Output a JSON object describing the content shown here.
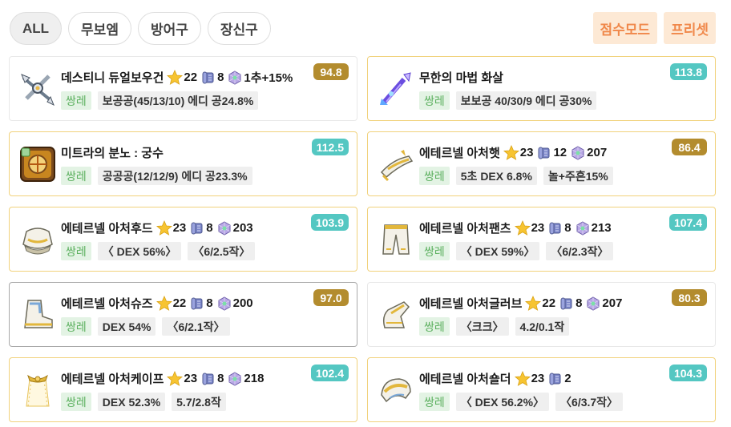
{
  "filters": {
    "tabs": [
      {
        "label": "ALL"
      },
      {
        "label": "무보엠"
      },
      {
        "label": "방어구"
      },
      {
        "label": "장신구"
      }
    ],
    "score_mode_label": "점수모드",
    "preset_label": "프리셋"
  },
  "colors": {
    "score_gold": "#b38c2e",
    "score_teal": "#54c7c2",
    "accent_orange": "#f0884a",
    "set_green": "#5cb05f"
  },
  "items": [
    {
      "name": "데스티니 듀얼보우건",
      "stars": "22",
      "scrolls": "8",
      "potential": "1추+15%",
      "set": "쌍레",
      "tags": [
        "보공공(45/13/10) 에디 공24.8%"
      ],
      "score": "94.8",
      "score_color": "gold",
      "icon": "crossbow-icon"
    },
    {
      "name": "무한의 마법 화살",
      "stars": "",
      "scrolls": "",
      "potential": "",
      "set": "쌍레",
      "tags": [
        "보보공 40/30/9 에디 공30%"
      ],
      "score": "113.8",
      "score_color": "teal",
      "icon": "magic-arrow-icon"
    },
    {
      "name": "미트라의 분노 : 궁수",
      "stars": "",
      "scrolls": "",
      "potential": "",
      "set": "쌍레",
      "tags": [
        "공공공(12/12/9) 에디 공23.3%"
      ],
      "score": "112.5",
      "score_color": "teal",
      "icon": "emblem-icon"
    },
    {
      "name": "에테르넬 아처햇",
      "stars": "23",
      "scrolls": "12",
      "potential": "207",
      "set": "쌍레",
      "tags": [
        "5초 DEX 6.8%",
        "놀+주흔15%"
      ],
      "score": "86.4",
      "score_color": "gold",
      "icon": "hat-icon"
    },
    {
      "name": "에테르넬 아처후드",
      "stars": "23",
      "scrolls": "8",
      "potential": "203",
      "set": "쌍레",
      "tags": [
        "〈 DEX 56%〉",
        "〈6/2.5작〉"
      ],
      "score": "103.9",
      "score_color": "teal",
      "icon": "top-armor-icon"
    },
    {
      "name": "에테르넬 아처팬츠",
      "stars": "23",
      "scrolls": "8",
      "potential": "213",
      "set": "쌍레",
      "tags": [
        "〈 DEX 59%〉",
        "〈6/2.3작〉"
      ],
      "score": "107.4",
      "score_color": "teal",
      "icon": "pants-icon"
    },
    {
      "name": "에테르넬 아처슈즈",
      "stars": "22",
      "scrolls": "8",
      "potential": "200",
      "set": "쌍레",
      "tags": [
        "DEX 54%",
        "〈6/2.1작〉"
      ],
      "score": "97.0",
      "score_color": "gold",
      "icon": "shoes-icon"
    },
    {
      "name": "에테르넬 아처글러브",
      "stars": "22",
      "scrolls": "8",
      "potential": "207",
      "set": "쌍레",
      "tags": [
        "〈크크〉",
        "4.2/0.1작"
      ],
      "score": "80.3",
      "score_color": "gold",
      "icon": "glove-icon"
    },
    {
      "name": "에테르넬 아처케이프",
      "stars": "23",
      "scrolls": "8",
      "potential": "218",
      "set": "쌍레",
      "tags": [
        "DEX 52.3%",
        "5.7/2.8작"
      ],
      "score": "102.4",
      "score_color": "teal",
      "icon": "cape-icon"
    },
    {
      "name": "에테르넬 아처숄더",
      "stars": "23",
      "scrolls": "2",
      "potential": "",
      "set": "쌍레",
      "tags": [
        "〈 DEX 56.2%〉",
        "〈6/3.7작〉"
      ],
      "score": "104.3",
      "score_color": "teal",
      "icon": "shoulder-icon"
    }
  ]
}
